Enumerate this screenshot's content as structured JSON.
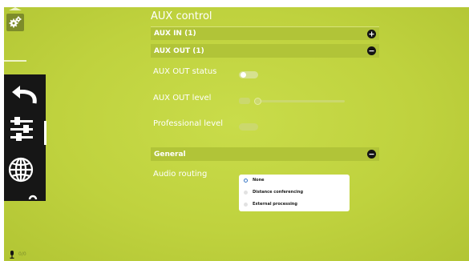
{
  "page_title": "AUX control",
  "sections": {
    "aux_in": {
      "title": "AUX IN (1)"
    },
    "aux_out": {
      "title": "AUX OUT (1)",
      "status_label": "AUX OUT status",
      "level_label": "AUX OUT level",
      "professional_label": "Professional level",
      "status_on": false,
      "professional_on": false,
      "level_fraction": 0
    },
    "general": {
      "title": "General",
      "routing_label": "Audio routing",
      "routing_options": [
        "None",
        "Distance conferencing",
        "External processing"
      ],
      "routing_selected": "None"
    }
  },
  "footer": {
    "mic_status": "0/0"
  },
  "icons": [
    "gear-icon",
    "back-arrow-icon",
    "sliders-icon",
    "globe-icon",
    "plus-icon",
    "minus-icon",
    "microphone-icon"
  ],
  "colors": {
    "background": "#c2d441",
    "section_bar": "#b1c438",
    "side_panel": "#161616",
    "radio_selected": "#3a78c6"
  }
}
